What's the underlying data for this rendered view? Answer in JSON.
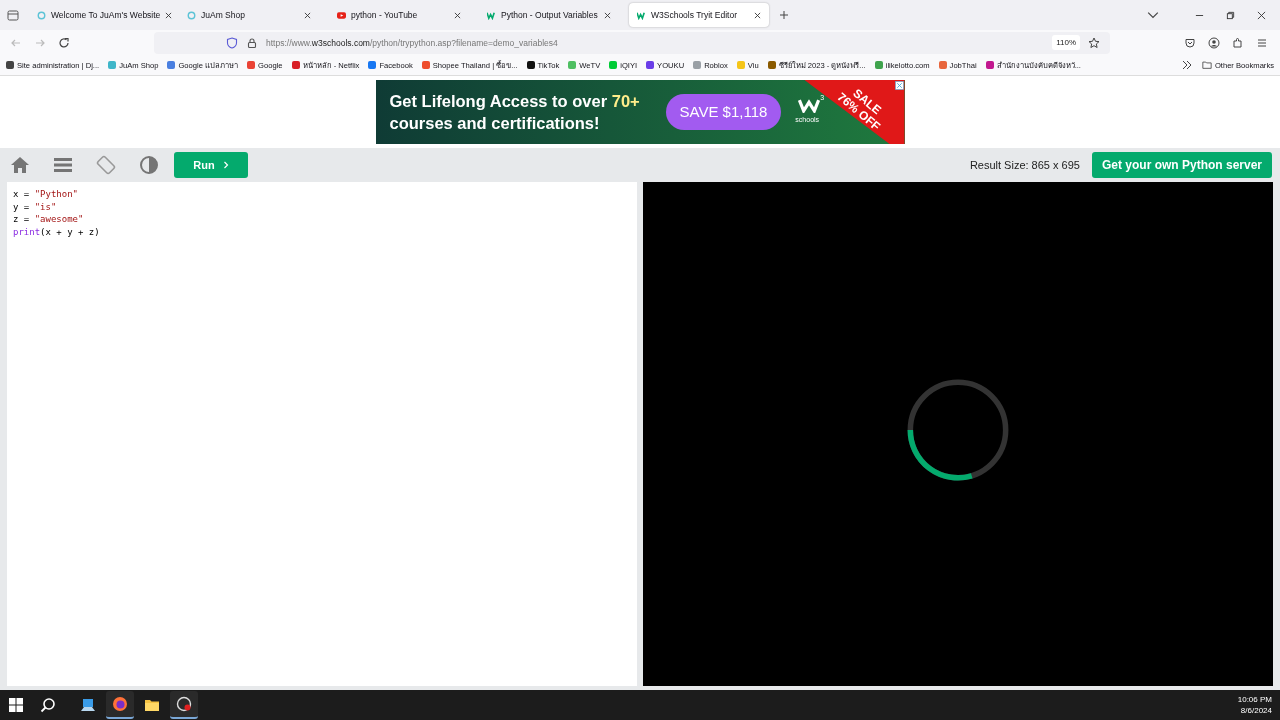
{
  "tabs": [
    {
      "title": "Welcome To JuAm's Website",
      "kind": "ring",
      "selected": false
    },
    {
      "title": "JuAm Shop",
      "kind": "ring",
      "selected": false
    },
    {
      "title": "python - YouTube",
      "kind": "play",
      "selected": false
    },
    {
      "title": "Python - Output Variables",
      "kind": "w3",
      "selected": false
    },
    {
      "title": "W3Schools Tryit Editor",
      "kind": "w3",
      "selected": true
    }
  ],
  "address": {
    "url_prefix": "https://www.",
    "url_host": "w3schools.com",
    "url_path": "/python/trypython.asp?filename=demo_variables4",
    "zoom": "110%"
  },
  "bookmarks": [
    {
      "label": "Site administration | Dj...",
      "color": "#444444"
    },
    {
      "label": "JuAm Shop",
      "color": "#3fb6c9"
    },
    {
      "label": "Google แปลภาษา",
      "color": "#4a7fe0"
    },
    {
      "label": "Google",
      "color": "#ea4335"
    },
    {
      "label": "หน้าหลัก - Netflix",
      "color": "#d81f26"
    },
    {
      "label": "Facebook",
      "color": "#1877f2"
    },
    {
      "label": "Shopee Thailand | ซื้อข...",
      "color": "#ee4d2d"
    },
    {
      "label": "TikTok",
      "color": "#111111"
    },
    {
      "label": "WeTV",
      "color": "#4fbf62"
    },
    {
      "label": "iQIYI",
      "color": "#00cc36"
    },
    {
      "label": "YOUKU",
      "color": "#6a3de8"
    },
    {
      "label": "Roblox",
      "color": "#9aa0a6"
    },
    {
      "label": "Viu",
      "color": "#f5c518"
    },
    {
      "label": "ซีรีย์ใหม่ 2023 - ดูหนังฟรี...",
      "color": "#8a5a00"
    },
    {
      "label": "ilikelotto.com",
      "color": "#3fa34d"
    },
    {
      "label": "JobThai",
      "color": "#e8663d"
    },
    {
      "label": "สำนักงานบังคับคดีจังหวั...",
      "color": "#c2188f"
    }
  ],
  "other_bookmarks": "Other Bookmarks",
  "ad": {
    "line1": "Get Lifelong Access to over",
    "highlight": "70+",
    "line2": "courses and certifications!",
    "cta": "SAVE $1,118",
    "brand_sup": "3",
    "brand": "schools",
    "ribbon_top": "SALE",
    "ribbon_bottom": "76% OFF"
  },
  "toolbar": {
    "run": "Run",
    "result_size": "Result Size: 865 x 695",
    "server": "Get your own Python server"
  },
  "code": [
    [
      {
        "t": "x = ",
        "kind": "plain"
      },
      {
        "t": "\"Python\"",
        "kind": "string"
      }
    ],
    [
      {
        "t": "y = ",
        "kind": "plain"
      },
      {
        "t": "\"is\"",
        "kind": "string"
      }
    ],
    [
      {
        "t": "z = ",
        "kind": "plain"
      },
      {
        "t": "\"awesome\"",
        "kind": "string"
      }
    ],
    [
      {
        "t": "print",
        "kind": "builtin"
      },
      {
        "t": "(x + y + z)",
        "kind": "plain"
      }
    ]
  ],
  "taskbar": {
    "apps": [
      {
        "kind": "explorer-blue",
        "running": false
      },
      {
        "kind": "firefox",
        "running": true
      },
      {
        "kind": "folder",
        "running": false
      },
      {
        "kind": "recorder",
        "running": true
      }
    ],
    "time": "10:06 PM",
    "date": "8/6/2024"
  }
}
